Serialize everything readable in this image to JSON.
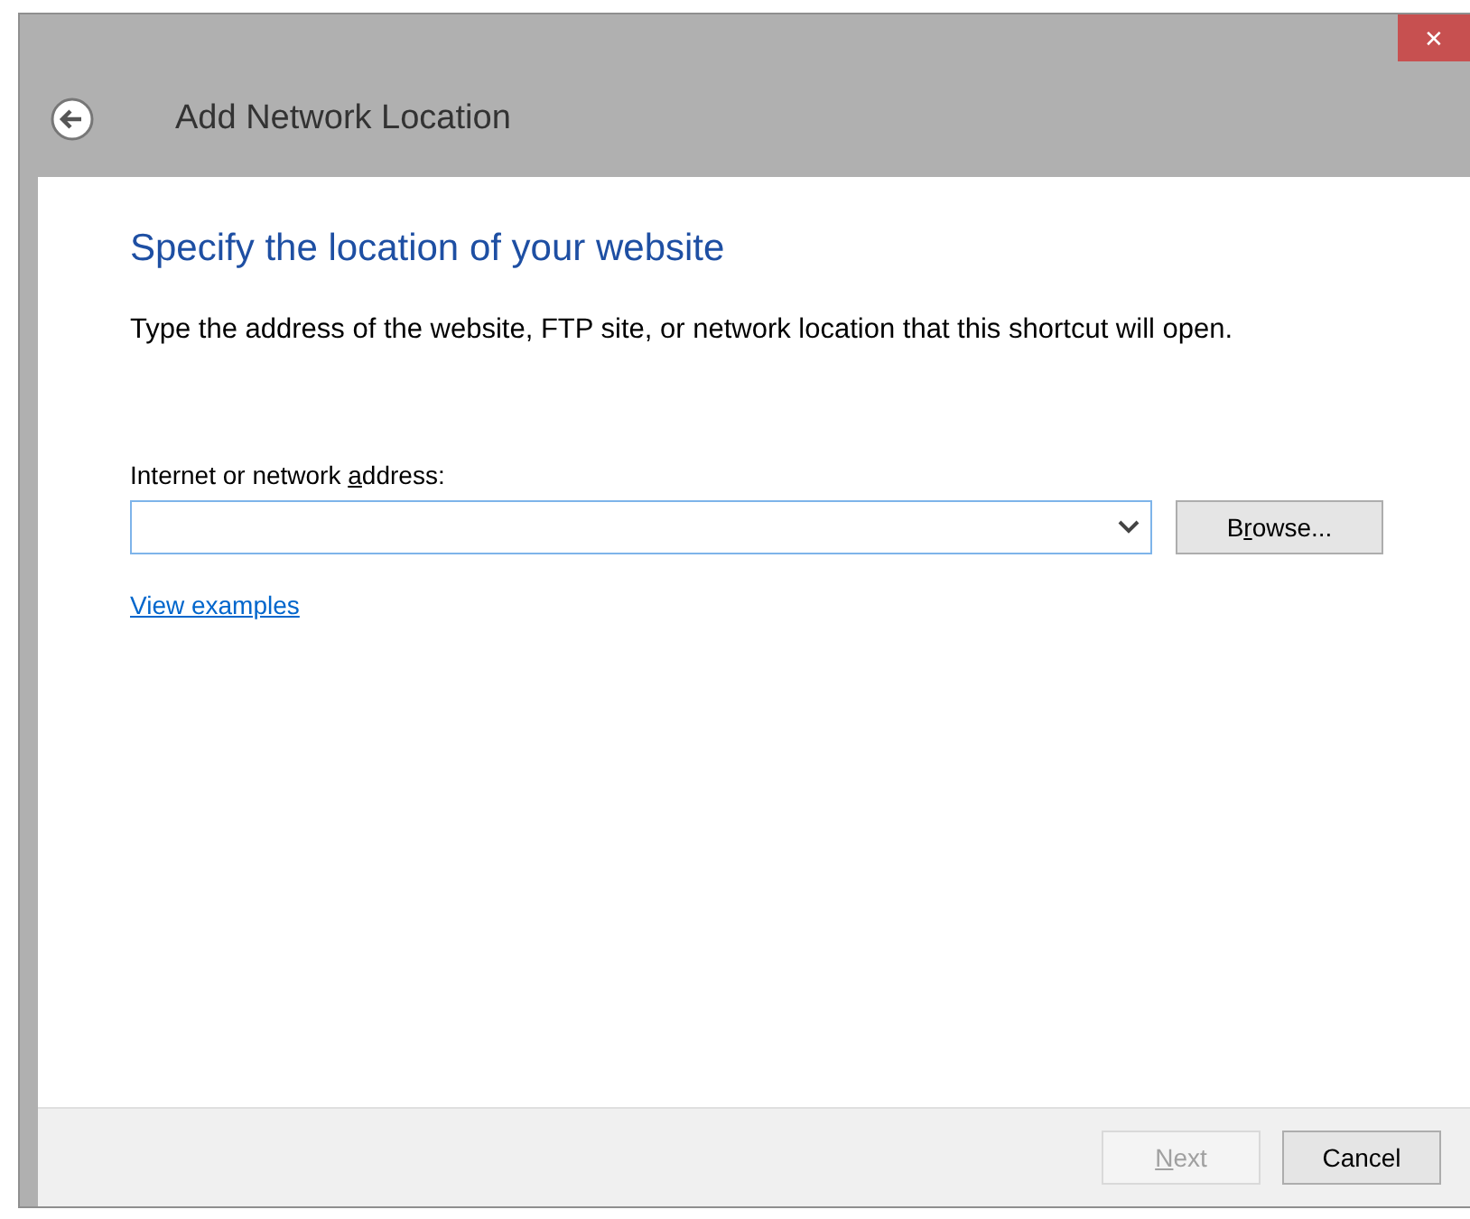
{
  "window": {
    "title": "Add Network Location",
    "close_label": "✕"
  },
  "heading": "Specify the location of your website",
  "description": "Type the address of the website, FTP site, or network location that this shortcut will open.",
  "address": {
    "label": {
      "before": "Internet or network ",
      "key": "a",
      "after": "ddress:"
    }
  },
  "browse": {
    "before": "B",
    "key": "r",
    "after": "owse..."
  },
  "link": "View examples",
  "buttons": [
    {
      "label": {
        "key": "N",
        "after": "ext"
      },
      "disabled": true
    },
    {
      "label": {
        "before": "Cancel"
      },
      "disabled": false
    }
  ]
}
